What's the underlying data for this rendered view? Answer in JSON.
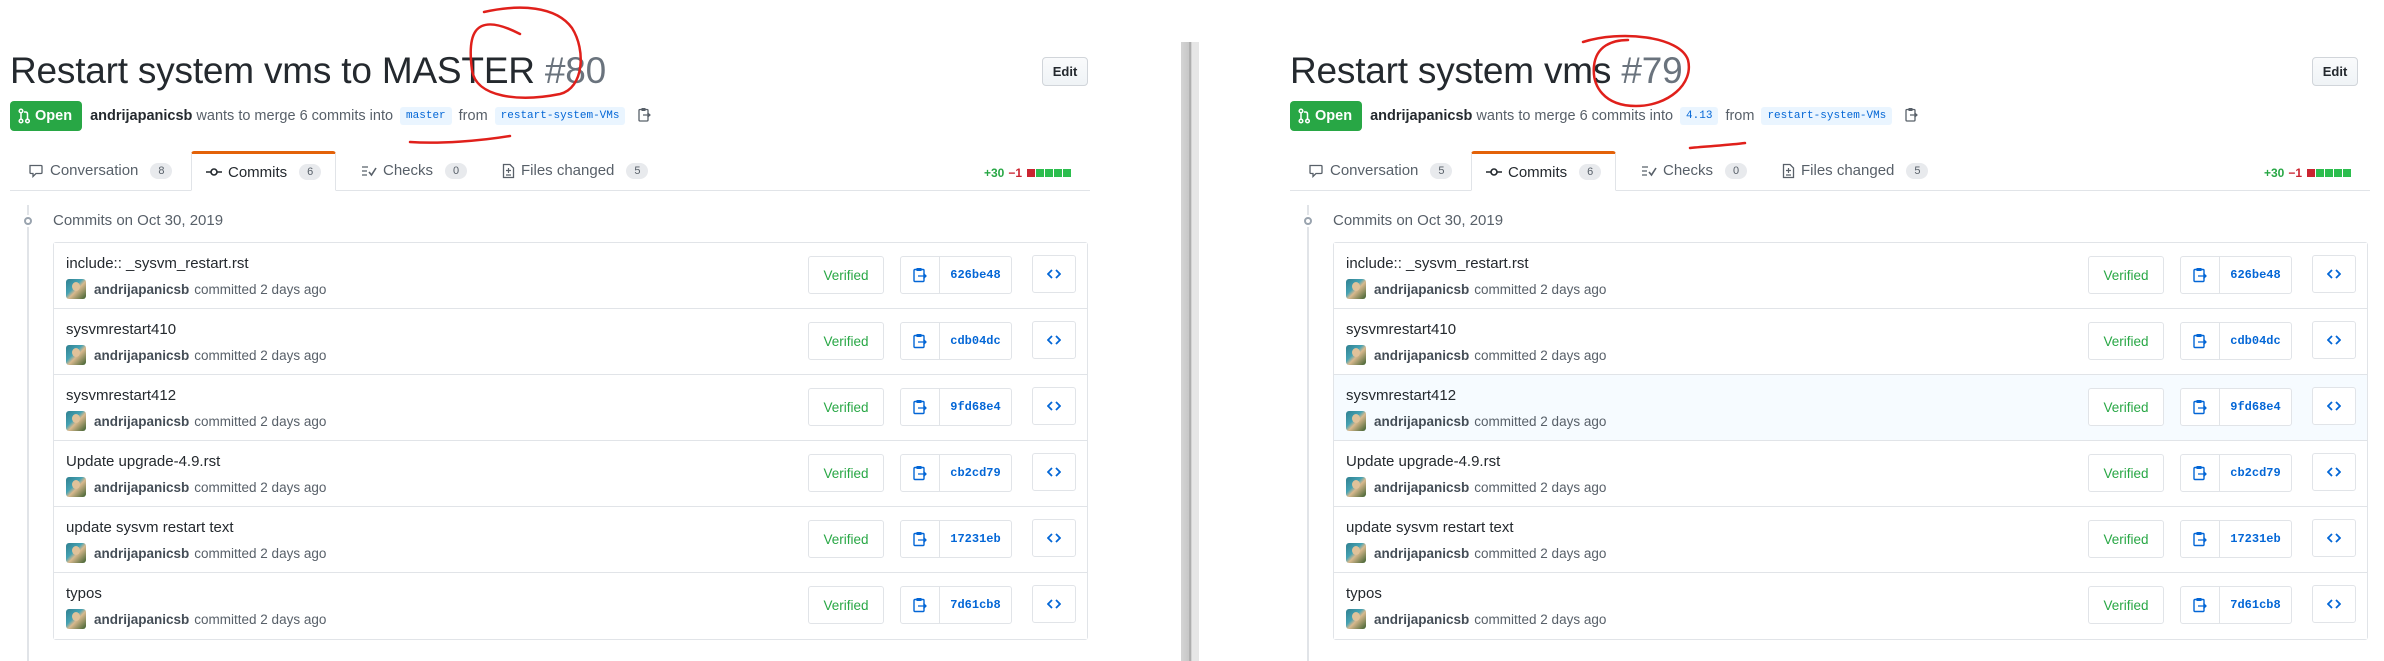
{
  "colors": {
    "open_green": "#28a745",
    "link_blue": "#0366d6",
    "tab_orange": "#e36209",
    "annotation_red": "#e0201b",
    "deletion_red": "#cb2431"
  },
  "panels": [
    {
      "title": "Restart system vms to MASTER",
      "number": "#80",
      "edit_label": "Edit",
      "state_label": "Open",
      "author": "andrijapanicsb",
      "merge_text": "wants to merge 6 commits into",
      "base_branch": "master",
      "from_text": "from",
      "head_branch": "restart-system-VMs",
      "tabs": [
        {
          "label": "Conversation",
          "count": "8"
        },
        {
          "label": "Commits",
          "count": "6"
        },
        {
          "label": "Checks",
          "count": "0"
        },
        {
          "label": "Files changed",
          "count": "5"
        }
      ],
      "diffstat": {
        "additions": "+30",
        "deletions": "−1"
      },
      "commits_date": "Commits on Oct 30, 2019",
      "commits": [
        {
          "message": "include:: _sysvm_restart.rst",
          "author": "andrijapanicsb",
          "when": "committed 2 days ago",
          "verified": "Verified",
          "sha": "626be48"
        },
        {
          "message": "sysvmrestart410",
          "author": "andrijapanicsb",
          "when": "committed 2 days ago",
          "verified": "Verified",
          "sha": "cdb04dc"
        },
        {
          "message": "sysvmrestart412",
          "author": "andrijapanicsb",
          "when": "committed 2 days ago",
          "verified": "Verified",
          "sha": "9fd68e4"
        },
        {
          "message": "Update upgrade-4.9.rst",
          "author": "andrijapanicsb",
          "when": "committed 2 days ago",
          "verified": "Verified",
          "sha": "cb2cd79"
        },
        {
          "message": "update sysvm restart text",
          "author": "andrijapanicsb",
          "when": "committed 2 days ago",
          "verified": "Verified",
          "sha": "17231eb"
        },
        {
          "message": "typos",
          "author": "andrijapanicsb",
          "when": "committed 2 days ago",
          "verified": "Verified",
          "sha": "7d61cb8"
        }
      ]
    },
    {
      "title": "Restart system vms",
      "number": "#79",
      "edit_label": "Edit",
      "state_label": "Open",
      "author": "andrijapanicsb",
      "merge_text": "wants to merge 6 commits into",
      "base_branch": "4.13",
      "from_text": "from",
      "head_branch": "restart-system-VMs",
      "tabs": [
        {
          "label": "Conversation",
          "count": "5"
        },
        {
          "label": "Commits",
          "count": "6"
        },
        {
          "label": "Checks",
          "count": "0"
        },
        {
          "label": "Files changed",
          "count": "5"
        }
      ],
      "diffstat": {
        "additions": "+30",
        "deletions": "−1"
      },
      "commits_date": "Commits on Oct 30, 2019",
      "commits": [
        {
          "message": "include:: _sysvm_restart.rst",
          "author": "andrijapanicsb",
          "when": "committed 2 days ago",
          "verified": "Verified",
          "sha": "626be48"
        },
        {
          "message": "sysvmrestart410",
          "author": "andrijapanicsb",
          "when": "committed 2 days ago",
          "verified": "Verified",
          "sha": "cdb04dc"
        },
        {
          "message": "sysvmrestart412",
          "author": "andrijapanicsb",
          "when": "committed 2 days ago",
          "verified": "Verified",
          "sha": "9fd68e4"
        },
        {
          "message": "Update upgrade-4.9.rst",
          "author": "andrijapanicsb",
          "when": "committed 2 days ago",
          "verified": "Verified",
          "sha": "cb2cd79"
        },
        {
          "message": "update sysvm restart text",
          "author": "andrijapanicsb",
          "when": "committed 2 days ago",
          "verified": "Verified",
          "sha": "17231eb"
        },
        {
          "message": "typos",
          "author": "andrijapanicsb",
          "when": "committed 2 days ago",
          "verified": "Verified",
          "sha": "7d61cb8"
        }
      ]
    }
  ]
}
